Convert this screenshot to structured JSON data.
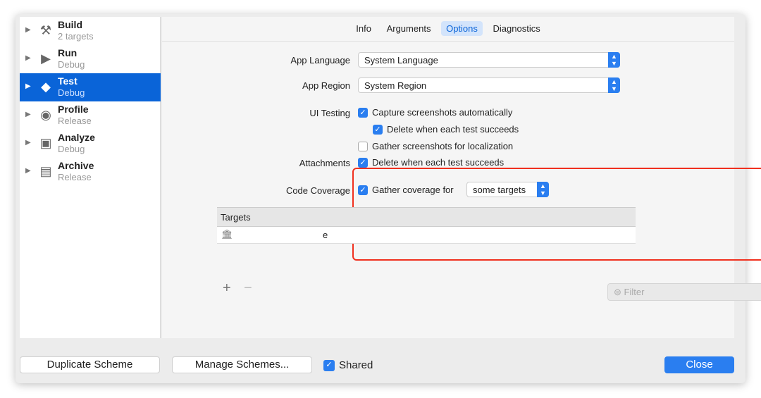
{
  "sidebar": {
    "items": [
      {
        "title": "Build",
        "subtitle": "2 targets",
        "icon": "hammer-icon"
      },
      {
        "title": "Run",
        "subtitle": "Debug",
        "icon": "play-icon"
      },
      {
        "title": "Test",
        "subtitle": "Debug",
        "icon": "test-diamond-icon",
        "selected": true
      },
      {
        "title": "Profile",
        "subtitle": "Release",
        "icon": "gauge-icon"
      },
      {
        "title": "Analyze",
        "subtitle": "Debug",
        "icon": "analyze-icon"
      },
      {
        "title": "Archive",
        "subtitle": "Release",
        "icon": "archive-icon"
      }
    ]
  },
  "tabs": [
    "Info",
    "Arguments",
    "Options",
    "Diagnostics"
  ],
  "active_tab": "Options",
  "options": {
    "app_language_label": "App Language",
    "app_language": "System Language",
    "app_region_label": "App Region",
    "app_region": "System Region",
    "ui_testing_label": "UI Testing",
    "capture": "Capture screenshots automatically",
    "delete_success": "Delete when each test succeeds",
    "gather_loc": "Gather screenshots for localization",
    "attachments_label": "Attachments",
    "attach_delete": "Delete when each test succeeds",
    "coverage_label": "Code Coverage",
    "gather_coverage": "Gather coverage for",
    "coverage_scope": "some targets",
    "targets_header": "Targets",
    "target_name_visible": "e",
    "add": "+",
    "remove": "−",
    "filter_placeholder": "Filter"
  },
  "footer": {
    "duplicate": "Duplicate Scheme",
    "manage": "Manage Schemes...",
    "shared": "Shared",
    "close": "Close"
  },
  "colors": {
    "accent": "#2a7ef0",
    "selection": "#0a64d8",
    "highlight": "#f0301e"
  }
}
